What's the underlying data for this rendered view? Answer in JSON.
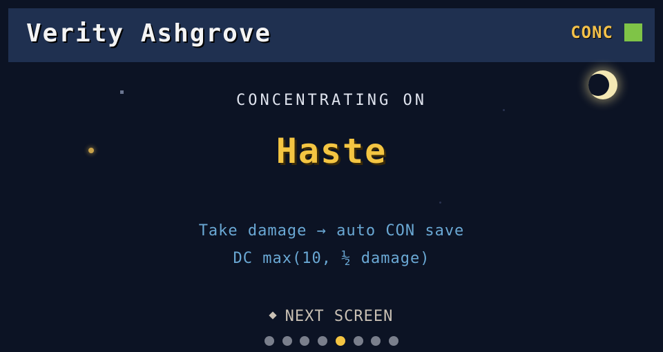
{
  "header": {
    "character_name": "Verity Ashgrove",
    "status_label": "CONC",
    "status_color": "#7fc447"
  },
  "decor": {
    "moon_icon": "crescent-moon-icon"
  },
  "main": {
    "kicker": "CONCENTRATING ON",
    "spell_name": "Haste",
    "rule_line_1": "Take damage → auto CON save",
    "rule_line_2": "DC max(10, ½ damage)"
  },
  "nav": {
    "next_label": "NEXT SCREEN",
    "page_count": 8,
    "current_page": 5
  },
  "colors": {
    "background": "#0c1324",
    "header_bg": "#1f3050",
    "accent_gold": "#f4c542",
    "rule_text": "#6aa8d4",
    "dot_inactive": "#7a7f8c"
  }
}
